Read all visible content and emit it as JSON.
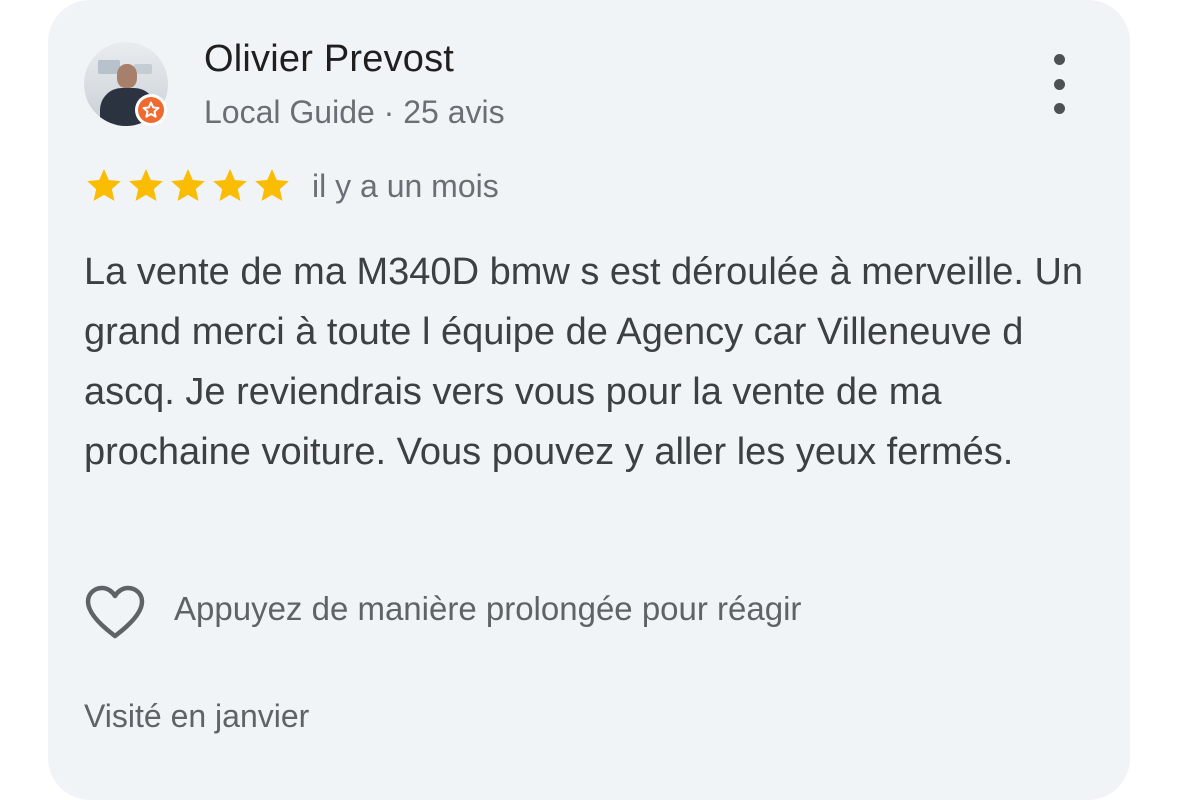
{
  "reviewer": {
    "name": "Olivier Prevost",
    "meta": "Local Guide · 25 avis",
    "badge_icon": "local-guide-star-icon",
    "badge_color": "#ef6a2e"
  },
  "more_menu_icon": "vertical-dots-icon",
  "rating": {
    "stars": 5,
    "max": 5,
    "star_color": "#fbbc04",
    "time_ago": "il y a un mois"
  },
  "review_text": "La vente de ma M340D bmw s est déroulée à merveille. Un grand merci à toute l équipe de Agency car Villeneuve d ascq. Je reviendrais vers vous pour la vente de ma prochaine voiture. Vous pouvez y aller les yeux fermés.",
  "reaction": {
    "icon": "heart-outline-icon",
    "label": "Appuyez de manière prolongée pour réagir"
  },
  "visited": "Visité en janvier"
}
